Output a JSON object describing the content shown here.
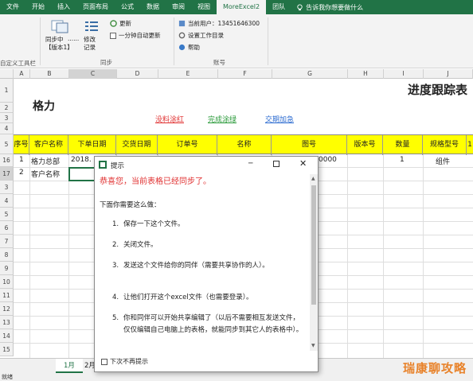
{
  "tabs": [
    "文件",
    "开始",
    "插入",
    "页面布局",
    "公式",
    "数据",
    "审阅",
    "视图",
    "MoreExcel2",
    "团队"
  ],
  "active_tab": "MoreExcel2",
  "tell_me": "告诉我你想要做什么",
  "ribbon": {
    "custom_toolbar": "自定义工具栏",
    "sync_btn_line1": "同步中",
    "sync_btn_dots": "......",
    "sync_btn_line2": "【版本1】",
    "modify_line1": "修改",
    "modify_line2": "记录",
    "update": "更新",
    "auto_update": "一分钟自动更新",
    "group_sync": "同步",
    "current_user": "当前用户：13451646300",
    "set_dir": "设置工作目录",
    "help": "帮助",
    "group_account": "账号"
  },
  "columns": [
    "A",
    "B",
    "C",
    "D",
    "E",
    "F",
    "G",
    "H",
    "I",
    "J"
  ],
  "rows": [
    "1",
    "2",
    "3",
    "4",
    "5",
    "16",
    "17",
    "3",
    "4",
    "5",
    "6",
    "7",
    "8",
    "9",
    "10",
    "11",
    "12",
    "13",
    "14",
    "15"
  ],
  "sheet": {
    "title": "进度跟踪表",
    "company": "格力",
    "legend_red": "没料涂红",
    "legend_green": "完成涂绿",
    "legend_blue": "交期加急",
    "headers": [
      "序号",
      "客户名称",
      "下单日期",
      "交货日期",
      "订单号",
      "名称",
      "图号",
      "版本号",
      "数量",
      "规格型号",
      "1"
    ],
    "row16": {
      "seq": "1",
      "customer": "格力总部",
      "date": "2018.",
      "drawing": "0000",
      "qty": "1",
      "spec": "组件"
    },
    "row17": {
      "seq": "2",
      "customer": "客户名称"
    },
    "small_rows": [
      "3",
      "4",
      "5",
      "6",
      "7",
      "8",
      "9",
      "10",
      "11",
      "12",
      "13",
      "14",
      "15"
    ]
  },
  "sheet_tabs": [
    "1月",
    "2月"
  ],
  "status": "就绪",
  "watermark": "瑞康聊攻略",
  "dialog": {
    "title": "提示",
    "congrats": "恭喜您，当前表格已经同步了。",
    "intro": "下面你需要这么做：",
    "steps": [
      {
        "n": "1.",
        "text": "保存一下这个文件。"
      },
      {
        "n": "2.",
        "text": "关闭文件。"
      },
      {
        "n": "3.",
        "text": "发送这个文件给你的同伴（需要共享协作的人）。"
      },
      {
        "n": "4.",
        "text": "让他们打开这个excel文件（也需要登录）。"
      },
      {
        "n": "5.",
        "text": "你和同伴可以开始共享编辑了（以后不需要相互发送文件，仅仅编辑自己电脑上的表格，就能同步到其它人的表格中）。"
      }
    ],
    "dont_show": "下次不再提示"
  },
  "colors": {
    "excel_green": "#217346",
    "red": "#e03030",
    "green": "#2a9a3a",
    "blue": "#2a6ad0",
    "yellow": "#ffff00"
  }
}
